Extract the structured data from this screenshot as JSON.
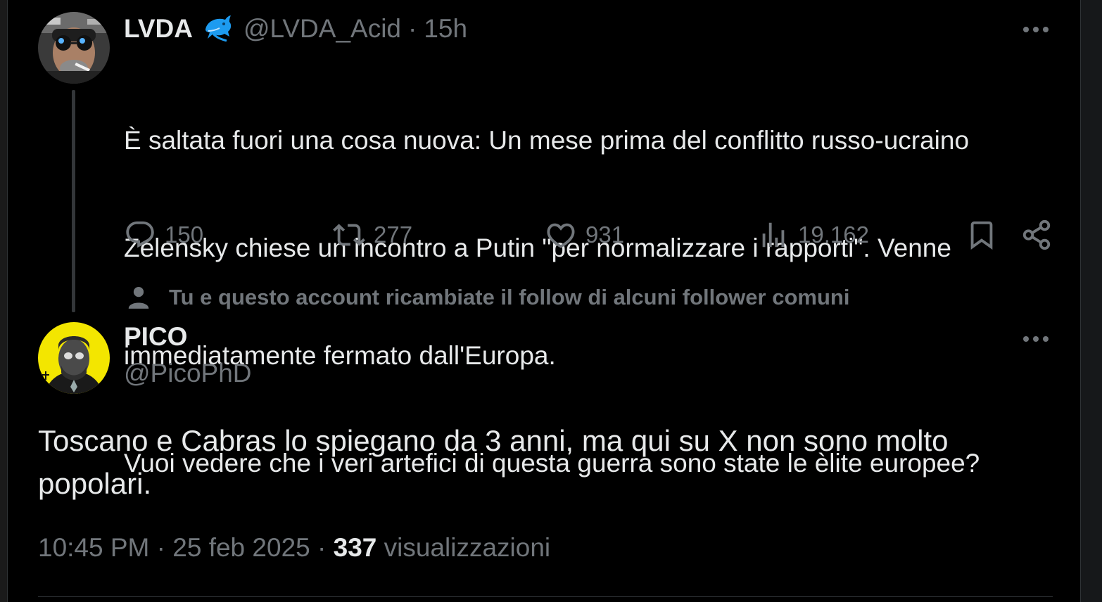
{
  "parent_tweet": {
    "display_name": "LVDA",
    "badge_icon": "dolphin-icon",
    "handle": "@LVDA_Acid",
    "separator": "·",
    "time_ago": "15h",
    "text_lines": [
      "È saltata fuori una cosa nuova: Un mese prima del conflitto russo-ucraino",
      "Zelensky chiese un incontro a Putin \"per normalizzare i rapporti\". Venne",
      "immediatamente fermato dall'Europa.",
      "Vuoi vedere che i veri artefici di questa guerra sono state le èlite europee?"
    ],
    "actions": {
      "replies": "150",
      "reposts": "277",
      "likes": "931",
      "views": "19.162"
    }
  },
  "follow_note": "Tu e questo account ricambiate il follow di alcuni follower comuni",
  "reply_tweet": {
    "display_name": "PICO",
    "handle": "@PicoPhD",
    "text_lines": [
      "Toscano e Cabras lo spiegano da 3 anni, ma qui su X non sono molto",
      "popolari."
    ],
    "time": "10:45 PM",
    "separator": "·",
    "date": "25 feb 2025",
    "views_count": "337",
    "views_label": "visualizzazioni"
  },
  "colors": {
    "background": "#000000",
    "primary_text": "#e7e9ea",
    "secondary_text": "#71767b",
    "divider": "#2f3336",
    "badge_blue": "#1d9bf0",
    "avatar_yellow": "#f3e600"
  }
}
